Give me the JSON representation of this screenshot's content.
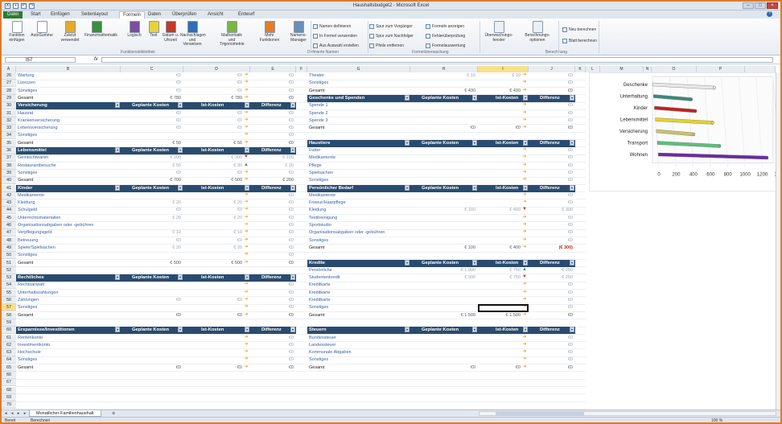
{
  "window": {
    "title": "Haushaltsbudget2 - Microsoft Excel",
    "minimize": "–",
    "maximize": "□",
    "close": "×"
  },
  "ribbon_tabs": [
    "Datei",
    "Start",
    "Einfügen",
    "Seitenlayout",
    "Formeln",
    "Daten",
    "Überprüfen",
    "Ansicht",
    "Entwurf"
  ],
  "ribbon": {
    "buttons": [
      {
        "label": "Funktion einfügen",
        "color": "#ffffff",
        "x": 4
      },
      {
        "label": "AutoSumme",
        "color": "#ffffff",
        "x": 35
      },
      {
        "label": "Zuletzt verwendet",
        "color": "#e8a92a",
        "x": 70
      },
      {
        "label": "Finanzmathematik",
        "color": "#3b8e3b",
        "x": 103
      },
      {
        "label": "Logisch",
        "color": "#7a4f9e",
        "x": 150
      },
      {
        "label": "Text",
        "color": "#e8d23a",
        "x": 174
      },
      {
        "label": "Datum u. Uhrzeit",
        "color": "#c0392b",
        "x": 195
      },
      {
        "label": "Nachschlagen und Verweisen",
        "color": "#2f6fb5",
        "x": 222
      },
      {
        "label": "Mathematik und Trigonometrie",
        "color": "#7ab83f",
        "x": 271
      },
      {
        "label": "Mehr Funktionen",
        "color": "#e07f2a",
        "x": 318
      },
      {
        "label": "Namens-Manager",
        "color": "#6a8fb8",
        "x": 354
      }
    ],
    "small_buttons": [
      {
        "label": "Namen definieren",
        "x": 387,
        "y": 6
      },
      {
        "label": "In Formel verwenden",
        "x": 387,
        "y": 18
      },
      {
        "label": "Aus Auswahl erstellen",
        "x": 387,
        "y": 30
      },
      {
        "label": "Spur zum Vorgänger",
        "x": 457,
        "y": 6
      },
      {
        "label": "Spur zum Nachfolger",
        "x": 457,
        "y": 18
      },
      {
        "label": "Pfeile entfernen",
        "x": 457,
        "y": 30
      },
      {
        "label": "Formeln anzeigen",
        "x": 527,
        "y": 6
      },
      {
        "label": "Fehlerüberprüfung",
        "x": 527,
        "y": 18
      },
      {
        "label": "Formelauswertung",
        "x": 527,
        "y": 30
      },
      {
        "label": "Neu berechnen",
        "x": 697,
        "y": 10
      },
      {
        "label": "Blatt berechnen",
        "x": 697,
        "y": 24
      }
    ],
    "big_right": [
      {
        "label": "Überwachungs-fenster",
        "x": 598
      },
      {
        "label": "Berechnungs-optionen",
        "x": 646
      }
    ],
    "groups": [
      {
        "label": "Funktionsbibliothek",
        "x": 148
      },
      {
        "label": "Definierte Namen",
        "x": 380
      },
      {
        "label": "Formelüberwachung",
        "x": 510
      },
      {
        "label": "Berechnung",
        "x": 676
      }
    ]
  },
  "formula_bar": {
    "name_box": "I57",
    "fx": "fx",
    "formula": ""
  },
  "columns": [
    {
      "label": "A",
      "x": 0,
      "w": 18
    },
    {
      "label": "B",
      "x": 18,
      "w": 130
    },
    {
      "label": "C",
      "x": 148,
      "w": 78
    },
    {
      "label": "D",
      "x": 226,
      "w": 83
    },
    {
      "label": "E",
      "x": 309,
      "w": 57
    },
    {
      "label": "F",
      "x": 366,
      "w": 14
    },
    {
      "label": "G",
      "x": 380,
      "w": 128
    },
    {
      "label": "H",
      "x": 508,
      "w": 84
    },
    {
      "label": "I",
      "x": 592,
      "w": 63
    },
    {
      "label": "J",
      "x": 655,
      "w": 58
    },
    {
      "label": "K",
      "x": 713,
      "w": 13
    },
    {
      "label": "L",
      "x": 726,
      "w": 18
    },
    {
      "label": "M",
      "x": 744,
      "w": 54
    },
    {
      "label": "N",
      "x": 798,
      "w": 10
    },
    {
      "label": "O",
      "x": 808,
      "w": 56
    },
    {
      "label": "P",
      "x": 864,
      "w": 60
    },
    {
      "label": "",
      "x": 924,
      "w": 38
    }
  ],
  "rows": {
    "first": 26,
    "last": 70,
    "selected": 57
  },
  "header_labels": {
    "planned": "Geplante Kosten",
    "actual": "Ist-Kosten",
    "diff": "Differenz"
  },
  "left_sections": [
    {
      "title": "",
      "header_row": null,
      "items": [
        {
          "row": 26,
          "label": "Wartung",
          "planned": "€0",
          "actual": "€0",
          "arrow": "y",
          "diff": "€0"
        },
        {
          "row": 27,
          "label": "Lizenzen",
          "planned": "€0",
          "actual": "€0",
          "arrow": "y",
          "diff": "€0"
        },
        {
          "row": 28,
          "label": "Sonstiges",
          "planned": "€0",
          "actual": "€0",
          "arrow": "y",
          "diff": "€0"
        },
        {
          "row": 29,
          "label": "Gesamt",
          "planned": "€ 780",
          "actual": "€ 780",
          "arrow": "y",
          "diff": "€0",
          "total": true
        }
      ]
    },
    {
      "title": "Versicherung",
      "header_row": 30,
      "items": [
        {
          "row": 31,
          "label": "Hausrat",
          "planned": "€0",
          "actual": "€0",
          "arrow": "y",
          "diff": "€0"
        },
        {
          "row": 32,
          "label": "Krankenversicherung",
          "planned": "€0",
          "actual": "€0",
          "arrow": "y",
          "diff": "€0"
        },
        {
          "row": 33,
          "label": "Lebensversicherung",
          "planned": "€0",
          "actual": "€0",
          "arrow": "y",
          "diff": "€0"
        },
        {
          "row": 34,
          "label": "Sonstiges",
          "planned": "",
          "actual": "",
          "arrow": "y",
          "diff": "€0"
        },
        {
          "row": 35,
          "label": "Gesamt",
          "planned": "€ 50",
          "actual": "€ 50",
          "arrow": "y",
          "diff": "€0",
          "total": true
        }
      ]
    },
    {
      "title": "Lebensmittel",
      "header_row": 36,
      "items": [
        {
          "row": 37,
          "label": "Gemischtwaren",
          "planned": "€ 200",
          "actual": "€ 300",
          "arrow": "r",
          "diff": "€ 100"
        },
        {
          "row": 38,
          "label": "Restaurantbesuche",
          "planned": "€ 50",
          "actual": "€ 30",
          "arrow": "g",
          "diff": "€ 20"
        },
        {
          "row": 39,
          "label": "Sonstiges",
          "planned": "€0",
          "actual": "€0",
          "arrow": "y",
          "diff": "€0"
        },
        {
          "row": 40,
          "label": "Gesamt",
          "planned": "€ 700",
          "actual": "€ 500",
          "arrow": "y",
          "diff": "€ 200",
          "total": true
        }
      ]
    },
    {
      "title": "Kinder",
      "header_row": 41,
      "items": [
        {
          "row": 42,
          "label": "Medikamente",
          "planned": "",
          "actual": "",
          "arrow": "y",
          "diff": "€0"
        },
        {
          "row": 43,
          "label": "Kleidung",
          "planned": "€ 20",
          "actual": "€ 20",
          "arrow": "y",
          "diff": "€0"
        },
        {
          "row": 44,
          "label": "Schulgeld",
          "planned": "€0",
          "actual": "€0",
          "arrow": "y",
          "diff": "€0"
        },
        {
          "row": 45,
          "label": "Unterrichtsmaterialien",
          "planned": "€ 20",
          "actual": "€ 20",
          "arrow": "y",
          "diff": "€0"
        },
        {
          "row": 46,
          "label": "Organisationsabgaben oder -gebühren",
          "planned": "",
          "actual": "",
          "arrow": "y",
          "diff": "€0"
        },
        {
          "row": 47,
          "label": "Verpflegungsgeld",
          "planned": "€ 10",
          "actual": "€ 10",
          "arrow": "y",
          "diff": "€0"
        },
        {
          "row": 48,
          "label": "Betreuung",
          "planned": "€0",
          "actual": "€0",
          "arrow": "y",
          "diff": "€0"
        },
        {
          "row": 49,
          "label": "Spiele/Spielsachen",
          "planned": "€ 20",
          "actual": "€ 20",
          "arrow": "y",
          "diff": "€0"
        },
        {
          "row": 50,
          "label": "Sonstiges",
          "planned": "",
          "actual": "",
          "arrow": "y",
          "diff": "€0"
        },
        {
          "row": 51,
          "label": "Gesamt",
          "planned": "€ 500",
          "actual": "€ 500",
          "arrow": "y",
          "diff": "€0",
          "total": true
        }
      ]
    },
    {
      "title": "Rechtliches",
      "header_row": 53,
      "items": [
        {
          "row": 54,
          "label": "Rechtsanwalt",
          "planned": "",
          "actual": "",
          "arrow": "y",
          "diff": "€0"
        },
        {
          "row": 55,
          "label": "Unterhaltszahlungen",
          "planned": "",
          "actual": "",
          "arrow": "y",
          "diff": "€0"
        },
        {
          "row": 56,
          "label": "Zahlungen",
          "planned": "€0",
          "actual": "€0",
          "arrow": "y",
          "diff": "€0"
        },
        {
          "row": 57,
          "label": "Sonstiges",
          "planned": "",
          "actual": "",
          "arrow": "y",
          "diff": "€0"
        },
        {
          "row": 58,
          "label": "Gesamt",
          "planned": "€0",
          "actual": "€0",
          "arrow": "y",
          "diff": "€0",
          "total": true
        }
      ]
    },
    {
      "title": "Ersparnisse/Investitionen",
      "header_row": 60,
      "items": [
        {
          "row": 61,
          "label": "Rentenkonto",
          "planned": "",
          "actual": "",
          "arrow": "y",
          "diff": "€0"
        },
        {
          "row": 62,
          "label": "Investmentkonto",
          "planned": "",
          "actual": "",
          "arrow": "y",
          "diff": "€0"
        },
        {
          "row": 63,
          "label": "Hochschule",
          "planned": "",
          "actual": "",
          "arrow": "y",
          "diff": "€0"
        },
        {
          "row": 64,
          "label": "Sonstiges",
          "planned": "",
          "actual": "",
          "arrow": "y",
          "diff": "€0"
        },
        {
          "row": 65,
          "label": "Gesamt",
          "planned": "€0",
          "actual": "€0",
          "arrow": "y",
          "diff": "€0",
          "total": true
        }
      ]
    }
  ],
  "right_sections": [
    {
      "title": "",
      "header_row": null,
      "items": [
        {
          "row": 26,
          "label": "Theater",
          "planned": "€ 10",
          "actual": "€ 10",
          "arrow": "y",
          "diff": "€0"
        },
        {
          "row": 27,
          "label": "Sonstiges",
          "planned": "",
          "actual": "",
          "arrow": "y",
          "diff": "€0"
        },
        {
          "row": 28,
          "label": "Gesamt",
          "planned": "€ 430",
          "actual": "€ 430",
          "arrow": "y",
          "diff": "€0",
          "total": true
        }
      ]
    },
    {
      "title": "Geschenke und Spenden",
      "header_row": 29,
      "items": [
        {
          "row": 30,
          "label": "Spende 1",
          "planned": "",
          "actual": "",
          "arrow": "y",
          "diff": "€0"
        },
        {
          "row": 31,
          "label": "Spende 2",
          "planned": "",
          "actual": "",
          "arrow": "y",
          "diff": "€0"
        },
        {
          "row": 32,
          "label": "Spende 3",
          "planned": "",
          "actual": "",
          "arrow": "y",
          "diff": "€0"
        },
        {
          "row": 33,
          "label": "Gesamt",
          "planned": "€0",
          "actual": "€0",
          "arrow": "y",
          "diff": "€0",
          "total": true
        }
      ]
    },
    {
      "title": "Haustiere",
      "header_row": 35,
      "items": [
        {
          "row": 36,
          "label": "Futter",
          "planned": "",
          "actual": "",
          "arrow": "y",
          "diff": "€0"
        },
        {
          "row": 37,
          "label": "Medikamente",
          "planned": "",
          "actual": "",
          "arrow": "y",
          "diff": "€0"
        },
        {
          "row": 38,
          "label": "Pflege",
          "planned": "",
          "actual": "",
          "arrow": "y",
          "diff": "€0"
        },
        {
          "row": 39,
          "label": "Spielsachen",
          "planned": "",
          "actual": "",
          "arrow": "y",
          "diff": "€0"
        },
        {
          "row": 40,
          "label": "Sonstiges",
          "planned": "",
          "actual": "",
          "arrow": "y",
          "diff": "€0"
        },
        {
          "row": 41,
          "label": "Gesamt",
          "planned": "€0",
          "actual": "€0",
          "arrow": "y",
          "diff": "€0",
          "total": true
        }
      ]
    },
    {
      "title": "Persönlicher Bedarf",
      "header_row": 41,
      "items": [
        {
          "row": 42,
          "label": "Medikamente",
          "planned": "",
          "actual": "",
          "arrow": "y",
          "diff": "€0"
        },
        {
          "row": 43,
          "label": "Friseur/Haarpflege",
          "planned": "",
          "actual": "",
          "arrow": "y",
          "diff": "€0"
        },
        {
          "row": 44,
          "label": "Kleidung",
          "planned": "€ 100",
          "actual": "€ 400",
          "arrow": "r",
          "diff": "€ 300"
        },
        {
          "row": 45,
          "label": "Textilreinigung",
          "planned": "",
          "actual": "",
          "arrow": "y",
          "diff": "€0"
        },
        {
          "row": 46,
          "label": "Sportstudio",
          "planned": "",
          "actual": "",
          "arrow": "y",
          "diff": "€0"
        },
        {
          "row": 47,
          "label": "Organisationsabgaben oder -gebühren",
          "planned": "",
          "actual": "",
          "arrow": "y",
          "diff": "€0"
        },
        {
          "row": 48,
          "label": "Sonstiges",
          "planned": "",
          "actual": "",
          "arrow": "y",
          "diff": "€0"
        },
        {
          "row": 49,
          "label": "Gesamt",
          "planned": "€ 100",
          "actual": "€ 400",
          "arrow": "y",
          "diff": "(€ 300)",
          "total": true,
          "neg": true
        }
      ]
    },
    {
      "title": "Kredite",
      "header_row": 51,
      "items": [
        {
          "row": 52,
          "label": "Persönliche",
          "planned": "€ 1.000",
          "actual": "€ 750",
          "arrow": "g",
          "diff": "€ 250"
        },
        {
          "row": 53,
          "label": "Studentenkredit",
          "planned": "€ 500",
          "actual": "€ 750",
          "arrow": "r",
          "diff": "€ 250"
        },
        {
          "row": 54,
          "label": "Kreditkarte",
          "planned": "",
          "actual": "",
          "arrow": "y",
          "diff": "€0"
        },
        {
          "row": 55,
          "label": "Kreditkarte",
          "planned": "",
          "actual": "",
          "arrow": "y",
          "diff": "€0"
        },
        {
          "row": 56,
          "label": "Kreditkarte",
          "planned": "",
          "actual": "",
          "arrow": "y",
          "diff": "€0"
        },
        {
          "row": 57,
          "label": "Sonstiges",
          "planned": "",
          "actual": "",
          "arrow": "y",
          "diff": "€0"
        },
        {
          "row": 58,
          "label": "Gesamt",
          "planned": "€ 1.500",
          "actual": "€ 1.500",
          "arrow": "y",
          "diff": "€0",
          "total": true
        }
      ]
    },
    {
      "title": "Steuern",
      "header_row": 60,
      "items": [
        {
          "row": 61,
          "label": "Bundessteuer",
          "planned": "",
          "actual": "",
          "arrow": "y",
          "diff": "€0"
        },
        {
          "row": 62,
          "label": "Landessteuer",
          "planned": "",
          "actual": "",
          "arrow": "y",
          "diff": "€0"
        },
        {
          "row": 63,
          "label": "Kommunale Abgaben",
          "planned": "",
          "actual": "",
          "arrow": "y",
          "diff": "€0"
        },
        {
          "row": 64,
          "label": "Sonstiges",
          "planned": "",
          "actual": "",
          "arrow": "y",
          "diff": "€0"
        },
        {
          "row": 65,
          "label": "Gesamt",
          "planned": "€0",
          "actual": "€0",
          "arrow": "y",
          "diff": "€0",
          "total": true
        }
      ]
    }
  ],
  "chart_data": {
    "type": "bar",
    "orientation": "horizontal",
    "categories": [
      "Geschenke",
      "Unterhaltung",
      "Kinder",
      "Lebensmittel",
      "Versicherung",
      "Transport",
      "Wohnen"
    ],
    "values": [
      720,
      450,
      500,
      700,
      480,
      780,
      1330
    ],
    "colors": [
      "#e8e8e8",
      "#3a8a7a",
      "#c0221c",
      "#e7d321",
      "#c9c26a",
      "#5bbf78",
      "#6b2aa0"
    ],
    "xlim": [
      0,
      1400
    ],
    "ticks": [
      "0",
      "200",
      "400",
      "600",
      "800",
      "1000",
      "1200",
      "1400"
    ],
    "title": "",
    "xlabel": "",
    "ylabel": ""
  },
  "sheet_tabs": {
    "active": "Monatlicher Familienhaushalt",
    "nav": "◂ ◂ ▸ ▸"
  },
  "status": {
    "mode": "Bereit",
    "macro": "Berechnen",
    "zoom": "100 %"
  },
  "colors": {
    "header_bg": "#2a4b6e",
    "accent": "#2d7a32",
    "frame": "#e07a2a"
  }
}
